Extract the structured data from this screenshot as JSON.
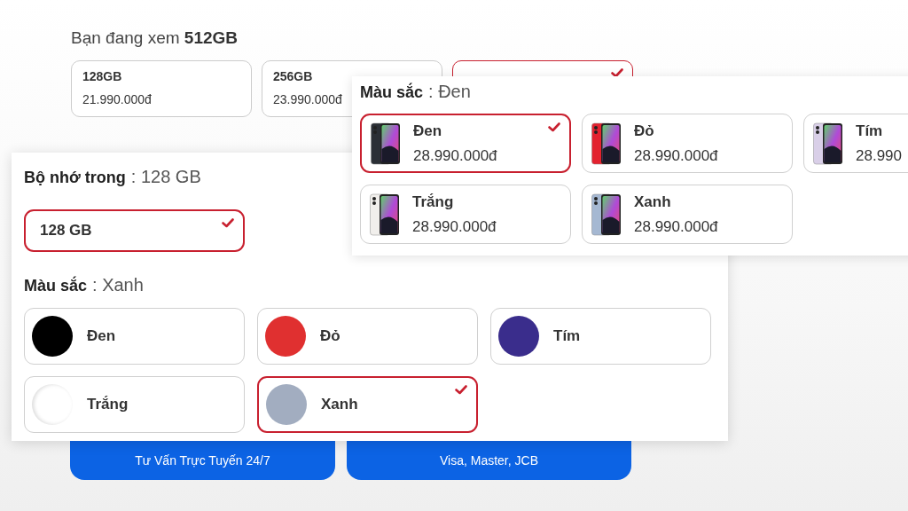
{
  "page": {
    "heading": "Bạn đang xem **512GB**",
    "storage_options": [
      {
        "label": "128GB",
        "price": "21.990.000đ",
        "selected": false
      },
      {
        "label": "256GB",
        "price": "23.990.000đ",
        "selected": false
      },
      {
        "selected": true
      }
    ],
    "contact_buttons": [
      {
        "subtitle": "Tư Vấn Trực Tuyến 24/7"
      },
      {
        "subtitle": "Visa, Master, JCB"
      }
    ]
  },
  "color_panel": {
    "label": "Màu sắc",
    "value": ": Đen",
    "options": [
      {
        "name": "Đen",
        "price": "28.990.000đ",
        "color": "#2b2f36",
        "selected": true
      },
      {
        "name": "Đỏ",
        "price": "28.990.000đ",
        "color": "#e3222f",
        "selected": false
      },
      {
        "name": "Tím",
        "price": "28.990",
        "color": "#d9cfe8",
        "selected": false
      },
      {
        "name": "Trắng",
        "price": "28.990.000đ",
        "color": "#f1efec",
        "selected": false
      },
      {
        "name": "Xanh",
        "price": "28.990.000đ",
        "color": "#a5b8d2",
        "selected": false
      }
    ]
  },
  "option_panel": {
    "storage": {
      "label": "Bộ nhớ trong",
      "value": ": 128 GB",
      "options": [
        {
          "label": "128 GB",
          "selected": true
        }
      ]
    },
    "colors": {
      "label": "Màu sắc",
      "value": ": Xanh",
      "options": [
        {
          "name": "Đen",
          "color": "#000000",
          "selected": false
        },
        {
          "name": "Đỏ",
          "color": "#e03030",
          "selected": false
        },
        {
          "name": "Tím",
          "color": "#3a2d8c",
          "selected": false
        },
        {
          "name": "Trắng",
          "color": "#ffffff",
          "selected": false
        },
        {
          "name": "Xanh",
          "color": "#a2adc0",
          "selected": true
        }
      ]
    }
  }
}
